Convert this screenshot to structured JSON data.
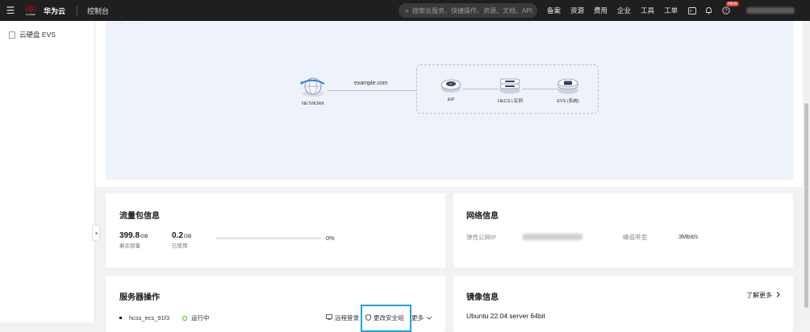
{
  "topbar": {
    "brand": "华为云",
    "brand_sub": "HUAWEI",
    "console": "控制台",
    "search_placeholder": "搜索云服务、快捷操作、资源、文档、API",
    "nav": [
      "备案",
      "资源",
      "费用",
      "企业",
      "工具",
      "工单"
    ],
    "badge": "NEW",
    "icons": [
      "terminal-icon",
      "bell-icon",
      "help-icon"
    ]
  },
  "sidebar": {
    "items": [
      {
        "label": "云硬盘 EVS",
        "icon": "disk-icon"
      }
    ],
    "collapse_glyph": "◂"
  },
  "diagram": {
    "fragment": "··· ·· ·",
    "nodes": [
      {
        "label": "NETWORK",
        "icon": "globe-network-icon"
      },
      {
        "label": "EIP",
        "icon": "eip-disc-icon"
      },
      {
        "label": "HECS L实例",
        "icon": "server-stack-icon"
      },
      {
        "label": "EVS (系统)",
        "icon": "disk-icon"
      }
    ],
    "link_label": "example.com"
  },
  "traffic": {
    "title": "流量包信息",
    "remaining_value": "399.8",
    "remaining_unit": "GB",
    "remaining_label": "剩余容量",
    "used_value": "0.2",
    "used_unit": "GB",
    "used_label": "已使用",
    "used_fraction": 0.0,
    "percent": "0%"
  },
  "network": {
    "title": "网络信息",
    "eip_label": "弹性公网IP",
    "bandwidth_label": "峰值带宽",
    "bandwidth_value": "3Mbit/s"
  },
  "server_ops": {
    "title": "服务器操作",
    "server_name": "hcss_ecs_91f3",
    "status": "运行中",
    "ops": [
      "远程登录",
      "更改安全组",
      "更多"
    ]
  },
  "image": {
    "title": "镜像信息",
    "learn_more": "了解更多",
    "os": "Ubuntu 22.04 server 64bit"
  },
  "colors": {
    "topbar": "#1f1f1f",
    "accent": "#5e7ce0",
    "status_ok": "#50b01b",
    "highlight": "#1aa3e8",
    "brand_red": "#e60012"
  }
}
